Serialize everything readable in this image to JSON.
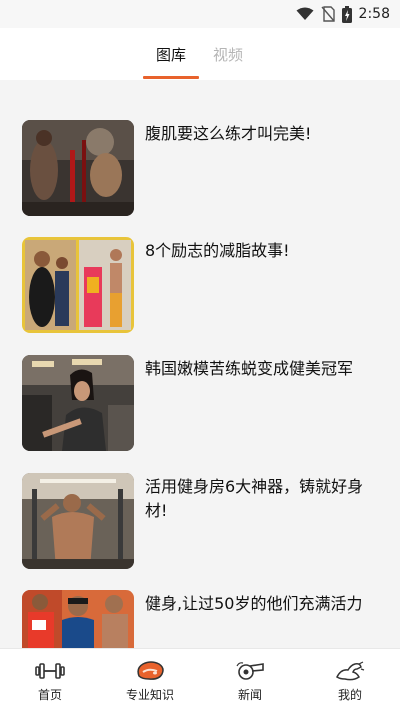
{
  "status_bar": {
    "time": "2:58"
  },
  "top_tabs": [
    {
      "label": "图库",
      "active": true
    },
    {
      "label": "视频",
      "active": false
    }
  ],
  "articles": [
    {
      "title": "腹肌要这么练才叫完美!"
    },
    {
      "title": "8个励志的减脂故事!"
    },
    {
      "title": "韩国嫩模苦练蜕变成健美冠军"
    },
    {
      "title": "活用健身房6大神器，铸就好身材!"
    },
    {
      "title": "健身,让过50岁的他们充满活力"
    }
  ],
  "bottom_nav": [
    {
      "label": "首页",
      "icon": "dumbbell-icon"
    },
    {
      "label": "专业知识",
      "icon": "meat-icon",
      "active": true
    },
    {
      "label": "新闻",
      "icon": "whistle-icon"
    },
    {
      "label": "我的",
      "icon": "flexed-arm-icon"
    }
  ],
  "colors": {
    "accent": "#e8622c",
    "inactive_tab": "#b5b5b5"
  }
}
